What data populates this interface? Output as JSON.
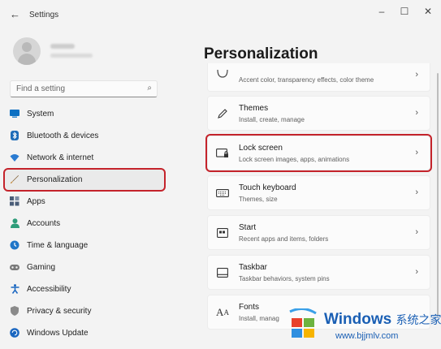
{
  "window": {
    "title": "Settings",
    "back_icon": "←",
    "minimize": "–",
    "maximize": "☐",
    "close": "✕"
  },
  "profile": {
    "name": "",
    "email": ""
  },
  "search": {
    "placeholder": "Find a setting",
    "icon": "⌕"
  },
  "sidebar": {
    "items": [
      {
        "label": "System",
        "icon": "monitor-icon",
        "color": "#0a6fc2"
      },
      {
        "label": "Bluetooth & devices",
        "icon": "bluetooth-icon",
        "color": "#1e6cb8"
      },
      {
        "label": "Network & internet",
        "icon": "wifi-icon",
        "color": "#2a7bd1"
      },
      {
        "label": "Personalization",
        "icon": "brush-icon",
        "color": "#c28a3a",
        "active": true
      },
      {
        "label": "Apps",
        "icon": "apps-icon",
        "color": "#4a5d78"
      },
      {
        "label": "Accounts",
        "icon": "person-icon",
        "color": "#2e9d7a"
      },
      {
        "label": "Time & language",
        "icon": "globe-clock-icon",
        "color": "#1f76c8"
      },
      {
        "label": "Gaming",
        "icon": "gamepad-icon",
        "color": "#7a7a7a"
      },
      {
        "label": "Accessibility",
        "icon": "accessibility-icon",
        "color": "#1a66c0"
      },
      {
        "label": "Privacy & security",
        "icon": "shield-icon",
        "color": "#8a8a8a"
      },
      {
        "label": "Windows Update",
        "icon": "update-icon",
        "color": "#1a66c0"
      }
    ]
  },
  "main": {
    "title": "Personalization",
    "cards": [
      {
        "title": "",
        "subtitle": "Accent color, transparency effects, color theme",
        "icon": "palette-icon"
      },
      {
        "title": "Themes",
        "subtitle": "Install, create, manage",
        "icon": "pen-icon"
      },
      {
        "title": "Lock screen",
        "subtitle": "Lock screen images, apps, animations",
        "icon": "lock-screen-icon",
        "highlight": true
      },
      {
        "title": "Touch keyboard",
        "subtitle": "Themes, size",
        "icon": "keyboard-icon"
      },
      {
        "title": "Start",
        "subtitle": "Recent apps and items, folders",
        "icon": "start-icon"
      },
      {
        "title": "Taskbar",
        "subtitle": "Taskbar behaviors, system pins",
        "icon": "taskbar-icon"
      },
      {
        "title": "Fonts",
        "subtitle": "Install, manag",
        "icon": "fonts-icon"
      }
    ]
  },
  "watermark": {
    "brand": "Windows",
    "brand_cn": "系统之家",
    "url": "www.bjjmlv.com"
  }
}
